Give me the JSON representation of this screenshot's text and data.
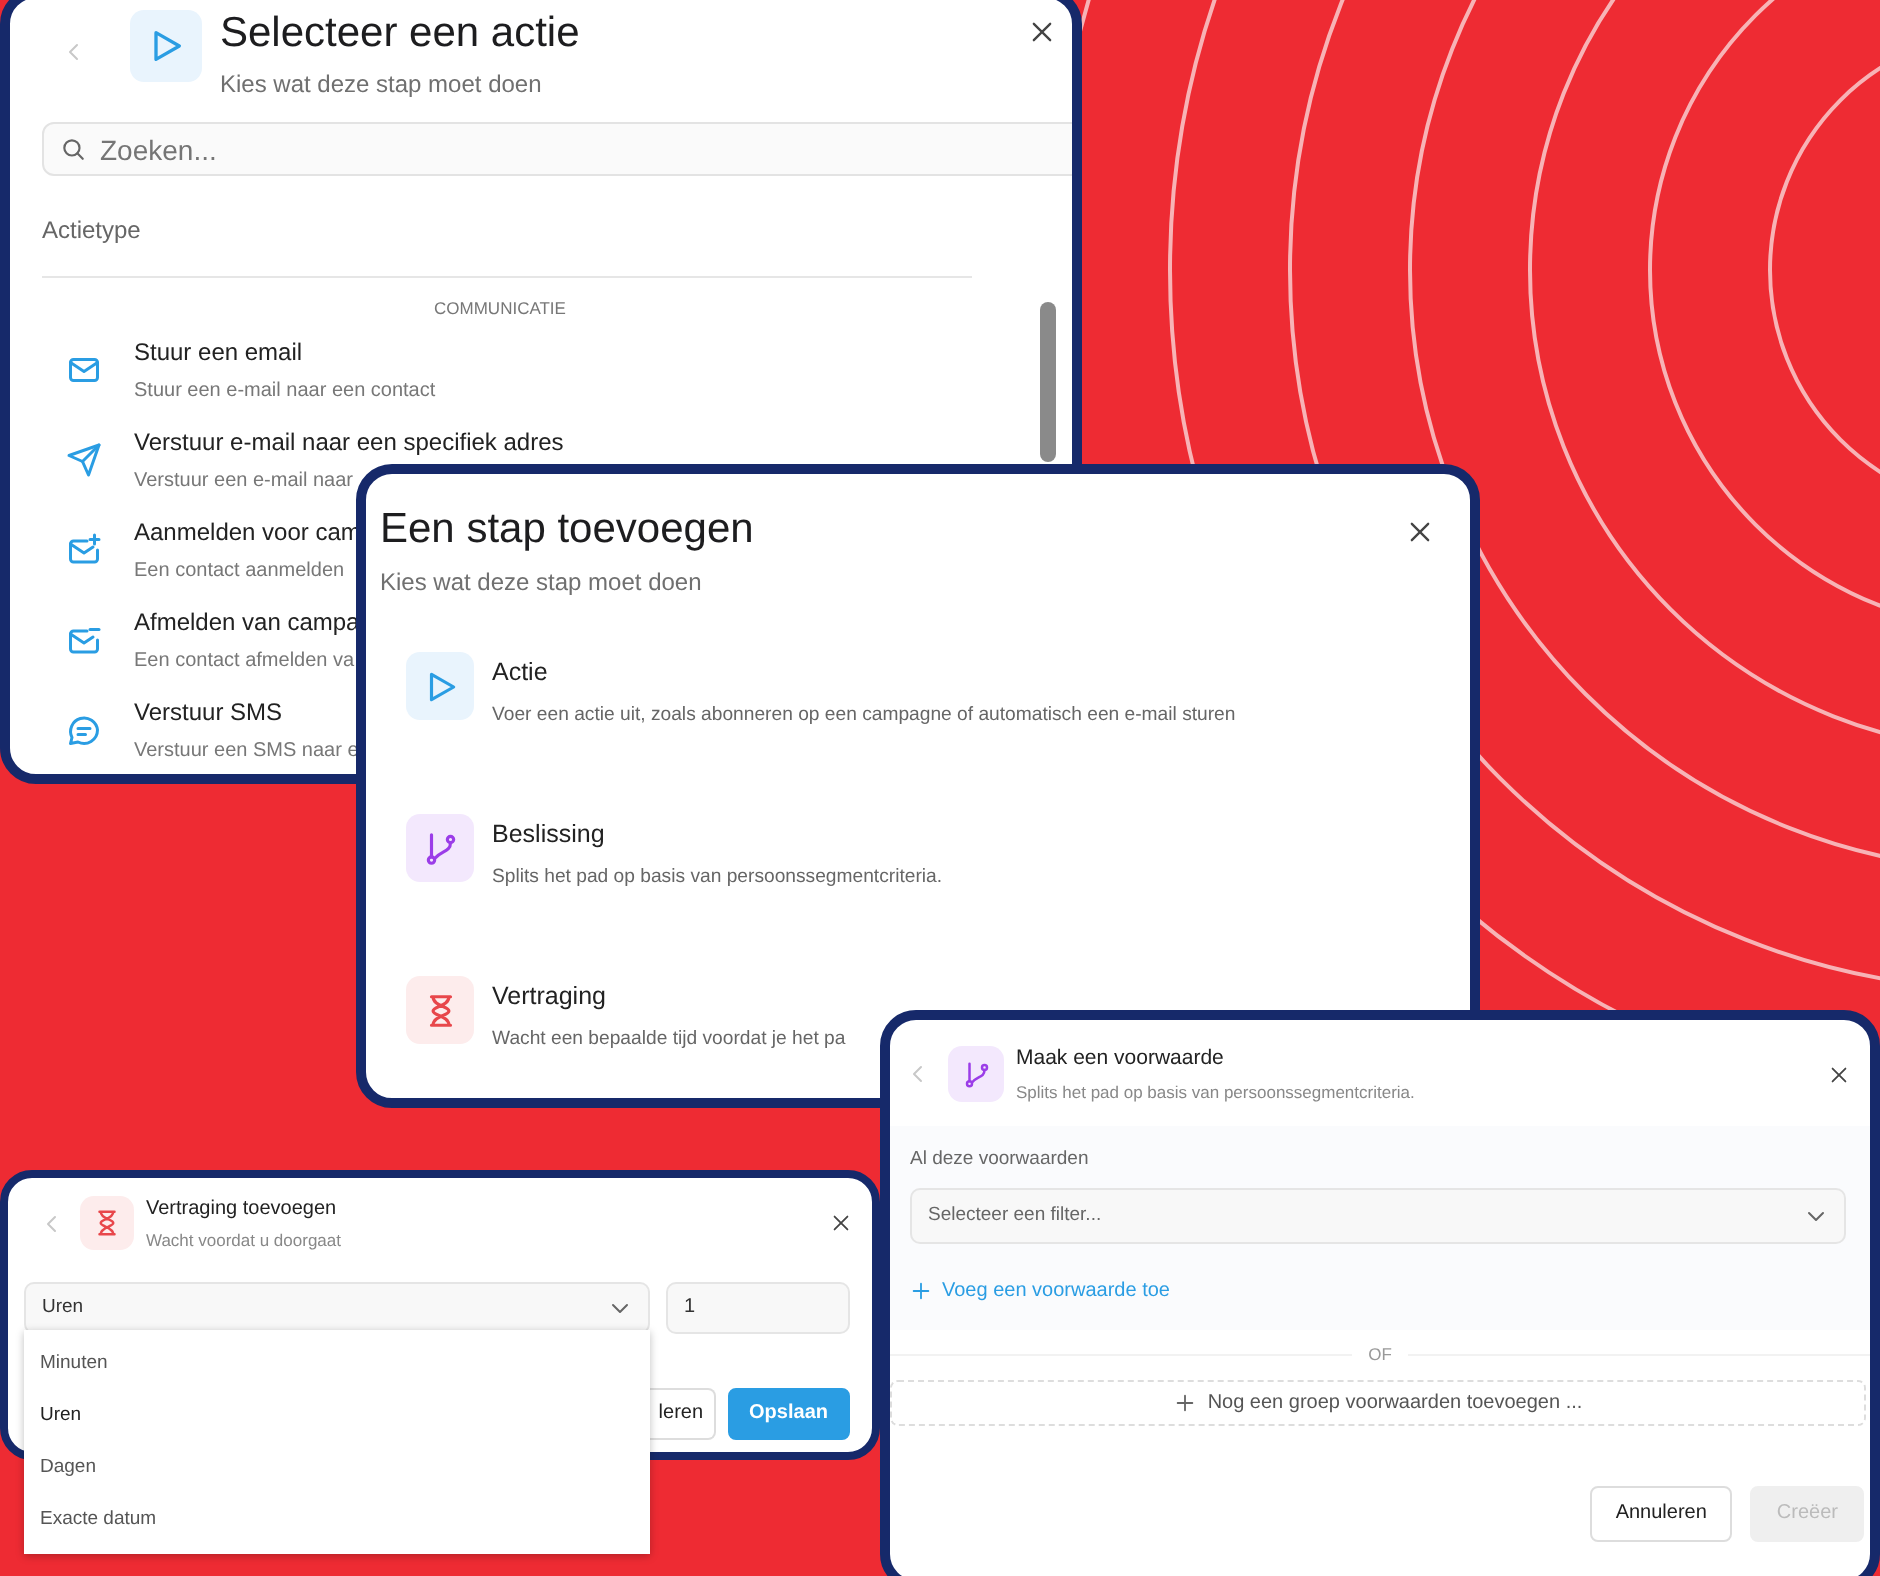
{
  "action_dialog": {
    "title": "Selecteer een actie",
    "subtitle": "Kies wat deze stap moet doen",
    "search": {
      "placeholder": "Zoeken..."
    },
    "section_label": "Actietype",
    "group_heading": "COMMUNICATIE",
    "actions": [
      {
        "kind": "mail",
        "title": "Stuur een email",
        "description": "Stuur een e-mail naar een contact"
      },
      {
        "kind": "send",
        "title": "Verstuur e-mail naar een specifiek adres",
        "description": "Verstuur een e-mail naar"
      },
      {
        "kind": "mail-plus",
        "title": "Aanmelden voor cam",
        "description": "Een contact aanmelden"
      },
      {
        "kind": "mail-minus",
        "title": "Afmelden van campa",
        "description": "Een contact afmelden va"
      },
      {
        "kind": "chat",
        "title": "Verstuur SMS",
        "description": "Verstuur een SMS naar e"
      }
    ]
  },
  "step_dialog": {
    "title": "Een stap toevoegen",
    "subtitle": "Kies wat deze stap moet doen",
    "options": [
      {
        "kind": "action",
        "title": "Actie",
        "description": "Voer een actie uit, zoals abonneren op een campagne of automatisch een e-mail sturen"
      },
      {
        "kind": "decision",
        "title": "Beslissing",
        "description": "Splits het pad op basis van persoonssegmentcriteria."
      },
      {
        "kind": "delay",
        "title": "Vertraging",
        "description": "Wacht een bepaalde tijd voordat je het pa"
      }
    ]
  },
  "delay_dialog": {
    "title": "Vertraging toevoegen",
    "subtitle": "Wacht voordat u doorgaat",
    "unit_select": {
      "value": "Uren"
    },
    "amount": {
      "value": "1"
    },
    "options": [
      {
        "label": "Minuten",
        "selected": false
      },
      {
        "label": "Uren",
        "selected": true
      },
      {
        "label": "Dagen",
        "selected": false
      },
      {
        "label": "Exacte datum",
        "selected": false
      }
    ],
    "buttons": [
      {
        "kind": "secondary",
        "label": "leren"
      },
      {
        "kind": "primary",
        "label": "Opslaan"
      }
    ]
  },
  "condition_dialog": {
    "title": "Maak een voorwaarde",
    "subtitle": "Splits het pad op basis van persoonssegmentcriteria.",
    "group_label": "Al deze voorwaarden",
    "filter_select": {
      "placeholder": "Selecteer een filter..."
    },
    "add_condition": "Voeg een voorwaarde toe",
    "separator": "OF",
    "add_group": "Nog een groep voorwaarden toevoegen ...",
    "buttons": [
      {
        "kind": "secondary",
        "label": "Annuleren",
        "disabled": false
      },
      {
        "kind": "primary",
        "label": "Creëer",
        "disabled": true
      }
    ]
  }
}
